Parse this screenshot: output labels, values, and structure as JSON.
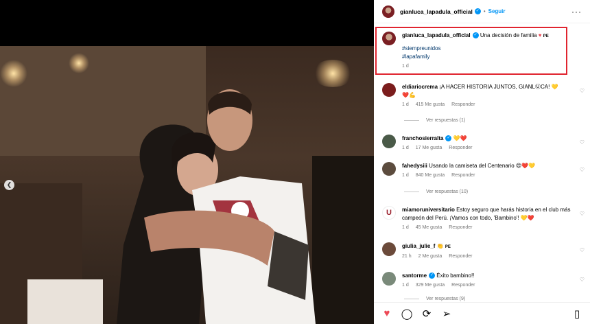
{
  "post": {
    "username": "gianluca_lapadula_official",
    "follow_label": "Seguir",
    "more_label": "···"
  },
  "caption": {
    "username": "gianluca_lapadula_official",
    "text": "Una decisión de familia",
    "flag": "PE",
    "hashtags": [
      "#siempreunidos",
      "#lapafamily"
    ],
    "time": "1 d"
  },
  "comments": [
    {
      "user": "eldiariocrema",
      "text": "¡A HACER HISTORIA JUNTOS, GIANLⓊCA!",
      "time": "1 d",
      "likes": "415 Me gusta",
      "reply": "Responder",
      "replies": "Ver respuestas (1)",
      "verified": false
    },
    {
      "user": "franchosierralta",
      "text": "",
      "time": "1 d",
      "likes": "17 Me gusta",
      "reply": "Responder",
      "replies": "",
      "verified": true
    },
    {
      "user": "fahedysiii",
      "text": "Usando la camiseta del Centenario",
      "time": "1 d",
      "likes": "840 Me gusta",
      "reply": "Responder",
      "replies": "Ver respuestas (10)",
      "verified": false
    },
    {
      "user": "miamoruniversitario",
      "text": "Estoy seguro que harás historia en el club más campeón del Perú. ¡Vamos con todo, 'Bambino'!",
      "time": "1 d",
      "likes": "45 Me gusta",
      "reply": "Responder",
      "replies": "",
      "verified": false
    },
    {
      "user": "giulia_julie_f",
      "text": "",
      "time": "21 h",
      "likes": "2 Me gusta",
      "reply": "Responder",
      "replies": "",
      "verified": false
    },
    {
      "user": "santorme",
      "text": "Éxito bambino!!",
      "time": "1 d",
      "likes": "329 Me gusta",
      "reply": "Responder",
      "replies": "Ver respuestas (9)",
      "verified": true
    }
  ],
  "colors": {
    "accent": "#0095f6",
    "highlight": "#e0242f",
    "like": "#ed4956"
  },
  "icons": [
    "heart-icon",
    "comment-icon",
    "share-icon",
    "bookmark-icon",
    "chevron-left-icon",
    "verified-icon",
    "more-icon"
  ]
}
